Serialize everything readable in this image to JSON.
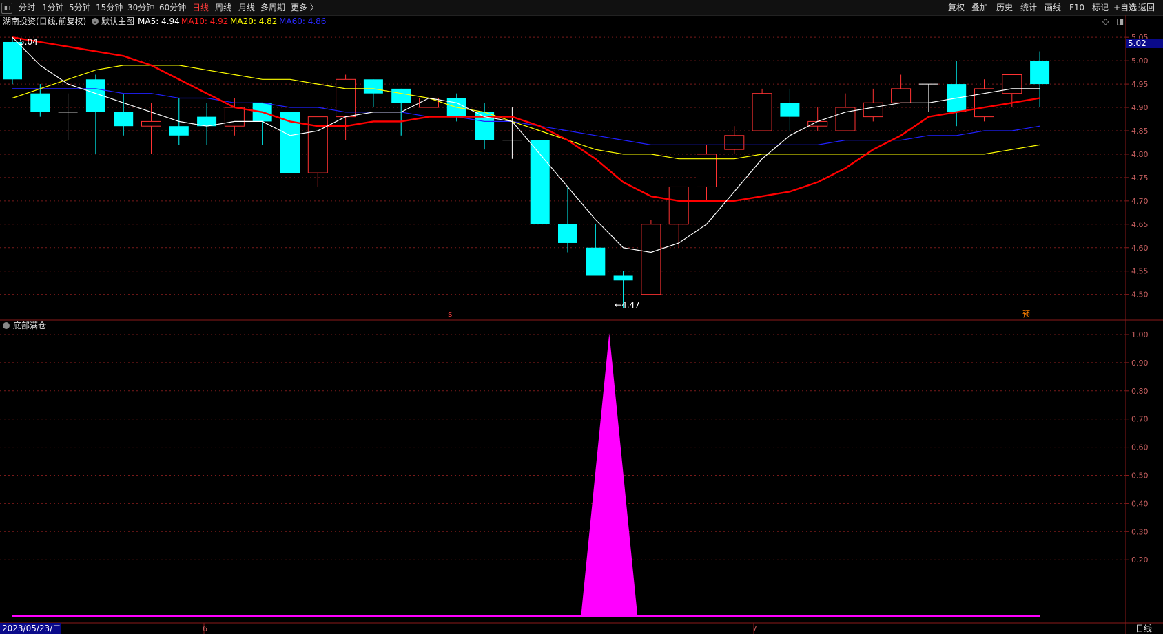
{
  "toolbar": {
    "items": [
      {
        "label": "分时",
        "active": false
      },
      {
        "label": "1分钟",
        "active": false
      },
      {
        "label": "5分钟",
        "active": false
      },
      {
        "label": "15分钟",
        "active": false
      },
      {
        "label": "30分钟",
        "active": false
      },
      {
        "label": "60分钟",
        "active": false
      },
      {
        "label": "日线",
        "active": true
      },
      {
        "label": "周线",
        "active": false
      },
      {
        "label": "月线",
        "active": false
      },
      {
        "label": "多周期",
        "active": false
      },
      {
        "label": "更多 〉",
        "active": false
      }
    ],
    "right_items": [
      "复权",
      "叠加",
      "历史",
      "统计",
      "画线",
      "F10",
      "标记",
      "+自选",
      "返回"
    ]
  },
  "info": {
    "stock_name": "湖南投资(日线,前复权)",
    "main_chart_label": "默认主图",
    "ma5": "MA5: 4.94",
    "ma10": "MA10: 4.92",
    "ma20": "MA20: 4.82",
    "ma60": "MA60: 4.86"
  },
  "colors": {
    "up": "#ff3232",
    "down": "#00ffff",
    "ma5": "#ffffff",
    "ma10": "#ff0000",
    "ma20": "#ffff00",
    "ma60": "#2020ff",
    "indicator": "#ff00ff",
    "grid": "#7a1a1a"
  },
  "price_axis": {
    "ticks": [
      "5.05",
      "5.00",
      "4.95",
      "4.90",
      "4.85",
      "4.80",
      "4.75",
      "4.70",
      "4.65",
      "4.60",
      "4.55",
      "4.50"
    ],
    "current": "5.02"
  },
  "annotations": {
    "high": "5.04",
    "low": "←4.47",
    "marker_s": "S",
    "marker_pred": "预"
  },
  "indicator": {
    "name": "底部满仓",
    "ticks": [
      "1.00",
      "0.90",
      "0.80",
      "0.70",
      "0.60",
      "0.50",
      "0.40",
      "0.30",
      "0.20"
    ]
  },
  "date_axis": {
    "date": "2023/05/23/二",
    "month_6": "6",
    "month_7": "7",
    "period": "日线"
  },
  "chart_data": {
    "type": "candlestick",
    "candles": [
      {
        "o": 5.04,
        "h": 5.05,
        "l": 4.95,
        "c": 4.96
      },
      {
        "o": 4.93,
        "h": 4.95,
        "l": 4.88,
        "c": 4.89
      },
      {
        "o": 4.89,
        "h": 4.93,
        "l": 4.83,
        "c": 4.89
      },
      {
        "o": 4.96,
        "h": 4.97,
        "l": 4.8,
        "c": 4.89
      },
      {
        "o": 4.89,
        "h": 4.93,
        "l": 4.84,
        "c": 4.86
      },
      {
        "o": 4.86,
        "h": 4.91,
        "l": 4.8,
        "c": 4.87
      },
      {
        "o": 4.86,
        "h": 4.92,
        "l": 4.82,
        "c": 4.84
      },
      {
        "o": 4.88,
        "h": 4.91,
        "l": 4.82,
        "c": 4.86
      },
      {
        "o": 4.86,
        "h": 4.92,
        "l": 4.84,
        "c": 4.9
      },
      {
        "o": 4.91,
        "h": 4.91,
        "l": 4.82,
        "c": 4.87
      },
      {
        "o": 4.89,
        "h": 4.89,
        "l": 4.76,
        "c": 4.76
      },
      {
        "o": 4.76,
        "h": 4.88,
        "l": 4.73,
        "c": 4.88
      },
      {
        "o": 4.88,
        "h": 4.97,
        "l": 4.83,
        "c": 4.96
      },
      {
        "o": 4.96,
        "h": 4.96,
        "l": 4.9,
        "c": 4.93
      },
      {
        "o": 4.94,
        "h": 4.94,
        "l": 4.84,
        "c": 4.91
      },
      {
        "o": 4.9,
        "h": 4.96,
        "l": 4.89,
        "c": 4.92
      },
      {
        "o": 4.92,
        "h": 4.93,
        "l": 4.87,
        "c": 4.88
      },
      {
        "o": 4.89,
        "h": 4.91,
        "l": 4.81,
        "c": 4.83
      },
      {
        "o": 4.83,
        "h": 4.9,
        "l": 4.79,
        "c": 4.83
      },
      {
        "o": 4.83,
        "h": 4.83,
        "l": 4.65,
        "c": 4.65
      },
      {
        "o": 4.65,
        "h": 4.73,
        "l": 4.59,
        "c": 4.61
      },
      {
        "o": 4.6,
        "h": 4.65,
        "l": 4.54,
        "c": 4.54
      },
      {
        "o": 4.54,
        "h": 4.55,
        "l": 4.47,
        "c": 4.53
      },
      {
        "o": 4.5,
        "h": 4.66,
        "l": 4.5,
        "c": 4.65
      },
      {
        "o": 4.65,
        "h": 4.73,
        "l": 4.6,
        "c": 4.73
      },
      {
        "o": 4.73,
        "h": 4.82,
        "l": 4.7,
        "c": 4.8
      },
      {
        "o": 4.81,
        "h": 4.86,
        "l": 4.8,
        "c": 4.84
      },
      {
        "o": 4.85,
        "h": 4.94,
        "l": 4.85,
        "c": 4.93
      },
      {
        "o": 4.91,
        "h": 4.94,
        "l": 4.85,
        "c": 4.88
      },
      {
        "o": 4.86,
        "h": 4.9,
        "l": 4.85,
        "c": 4.87
      },
      {
        "o": 4.85,
        "h": 4.93,
        "l": 4.85,
        "c": 4.9
      },
      {
        "o": 4.88,
        "h": 4.94,
        "l": 4.87,
        "c": 4.91
      },
      {
        "o": 4.91,
        "h": 4.97,
        "l": 4.91,
        "c": 4.94
      },
      {
        "o": 4.95,
        "h": 4.95,
        "l": 4.89,
        "c": 4.95
      },
      {
        "o": 4.95,
        "h": 5.0,
        "l": 4.86,
        "c": 4.89
      },
      {
        "o": 4.88,
        "h": 4.96,
        "l": 4.87,
        "c": 4.94
      },
      {
        "o": 4.93,
        "h": 4.97,
        "l": 4.9,
        "c": 4.97
      },
      {
        "o": 5.0,
        "h": 5.02,
        "l": 4.9,
        "c": 4.95
      }
    ],
    "ma5": [
      5.05,
      4.99,
      4.95,
      4.93,
      4.91,
      4.89,
      4.87,
      4.86,
      4.87,
      4.87,
      4.84,
      4.85,
      4.88,
      4.89,
      4.89,
      4.92,
      4.91,
      4.88,
      4.87,
      4.8,
      4.73,
      4.66,
      4.6,
      4.59,
      4.61,
      4.65,
      4.72,
      4.79,
      4.84,
      4.87,
      4.89,
      4.9,
      4.91,
      4.91,
      4.92,
      4.93,
      4.94,
      4.94
    ],
    "ma10": [
      5.05,
      5.04,
      5.03,
      5.02,
      5.01,
      4.99,
      4.96,
      4.93,
      4.9,
      4.89,
      4.87,
      4.86,
      4.86,
      4.87,
      4.87,
      4.88,
      4.88,
      4.88,
      4.88,
      4.86,
      4.83,
      4.79,
      4.74,
      4.71,
      4.7,
      4.7,
      4.7,
      4.71,
      4.72,
      4.74,
      4.77,
      4.81,
      4.84,
      4.88,
      4.89,
      4.9,
      4.91,
      4.92
    ],
    "ma20": [
      4.92,
      4.94,
      4.96,
      4.98,
      4.99,
      4.99,
      4.99,
      4.98,
      4.97,
      4.96,
      4.96,
      4.95,
      4.94,
      4.94,
      4.93,
      4.92,
      4.9,
      4.89,
      4.87,
      4.85,
      4.83,
      4.81,
      4.8,
      4.8,
      4.79,
      4.79,
      4.79,
      4.8,
      4.8,
      4.8,
      4.8,
      4.8,
      4.8,
      4.8,
      4.8,
      4.8,
      4.81,
      4.82
    ],
    "ma60": [
      4.94,
      4.94,
      4.94,
      4.94,
      4.93,
      4.93,
      4.92,
      4.92,
      4.91,
      4.91,
      4.9,
      4.9,
      4.89,
      4.89,
      4.89,
      4.88,
      4.88,
      4.87,
      4.87,
      4.86,
      4.85,
      4.84,
      4.83,
      4.82,
      4.82,
      4.82,
      4.82,
      4.82,
      4.82,
      4.82,
      4.83,
      4.83,
      4.83,
      4.84,
      4.84,
      4.85,
      4.85,
      4.86
    ],
    "indicator_values": [
      0,
      0,
      0,
      0,
      0,
      0,
      0,
      0,
      0,
      0,
      0,
      0,
      0,
      0,
      0,
      0,
      0,
      0,
      0,
      0,
      0,
      1,
      0,
      0,
      0,
      0,
      0,
      0,
      0,
      0,
      0,
      0,
      0,
      0,
      0,
      0,
      0,
      0
    ],
    "price_range": [
      4.445,
      5.065
    ],
    "indicator_range": [
      0,
      1.05
    ]
  }
}
